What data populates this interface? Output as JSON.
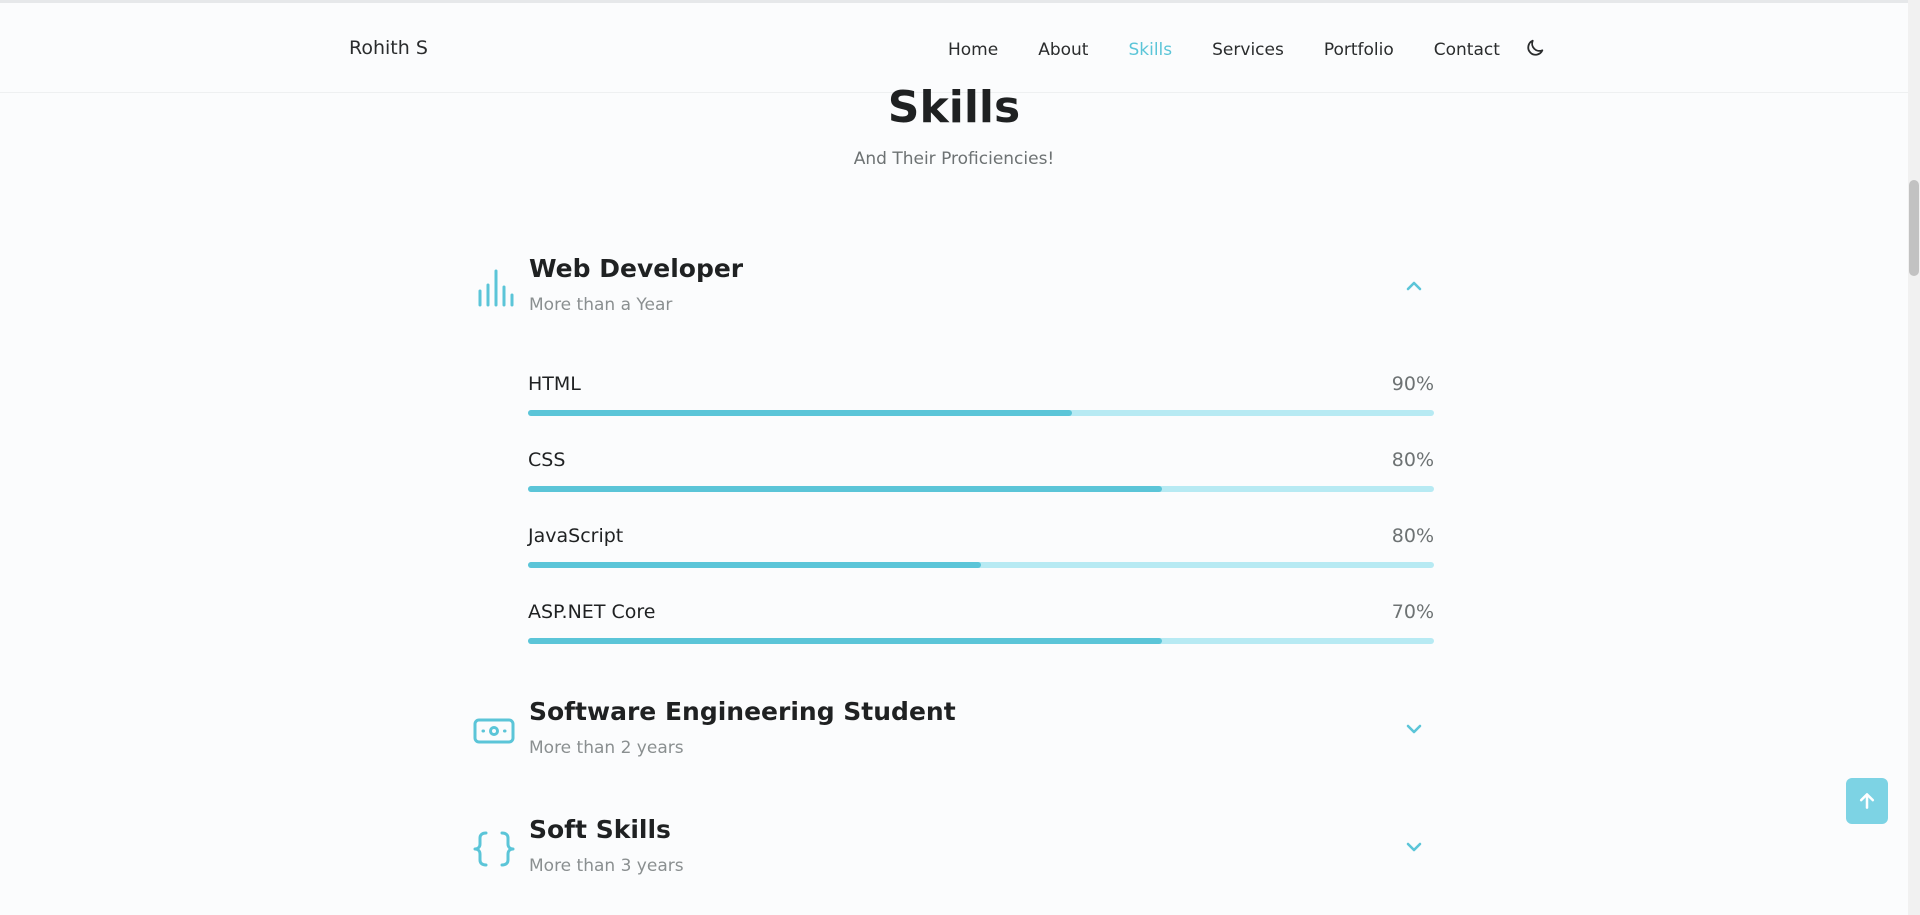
{
  "header": {
    "logo": "Rohith S",
    "nav": [
      {
        "label": "Home",
        "active": false
      },
      {
        "label": "About",
        "active": false
      },
      {
        "label": "Skills",
        "active": true
      },
      {
        "label": "Services",
        "active": false
      },
      {
        "label": "Portfolio",
        "active": false
      },
      {
        "label": "Contact",
        "active": false
      }
    ],
    "theme_icon": "moon-icon"
  },
  "section": {
    "title": "Skills",
    "subtitle": "And Their Proficiencies!"
  },
  "groups": [
    {
      "title": "Web Developer",
      "subtitle": "More than a Year",
      "icon": "bar-chart-icon",
      "expanded": true,
      "chevron": "chevron-up-icon",
      "skills": [
        {
          "name": "HTML",
          "percent_label": "90%",
          "fill_fraction": 0.6
        },
        {
          "name": "CSS",
          "percent_label": "80%",
          "fill_fraction": 0.7
        },
        {
          "name": "JavaScript",
          "percent_label": "80%",
          "fill_fraction": 0.5
        },
        {
          "name": "ASP.NET Core",
          "percent_label": "70%",
          "fill_fraction": 0.7
        }
      ]
    },
    {
      "title": "Software Engineering Student",
      "subtitle": "More than 2 years",
      "icon": "money-icon",
      "expanded": false,
      "chevron": "chevron-down-icon"
    },
    {
      "title": "Soft Skills",
      "subtitle": "More than 3 years",
      "icon": "braces-icon",
      "expanded": false,
      "chevron": "chevron-down-icon"
    }
  ],
  "scroll_top_icon": "arrow-up-icon",
  "colors": {
    "accent": "#5bc5d8",
    "bar_track": "#b7eaf3",
    "scroll_button": "#7dd3e4",
    "text": "#1f2122",
    "muted": "#8a8f90"
  }
}
